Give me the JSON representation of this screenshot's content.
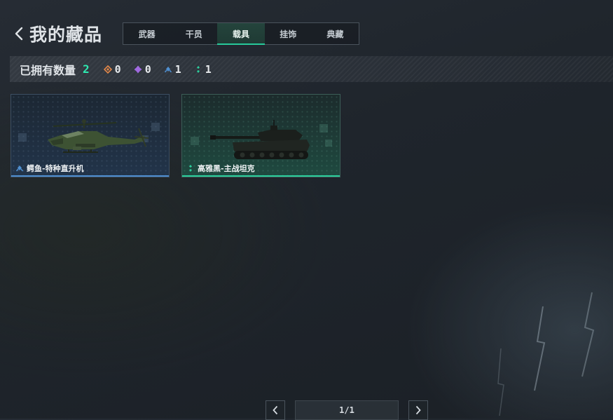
{
  "header": {
    "title": "我的藏品"
  },
  "tabs": [
    {
      "label": "武器",
      "active": false
    },
    {
      "label": "干员",
      "active": false
    },
    {
      "label": "载具",
      "active": true
    },
    {
      "label": "挂饰",
      "active": false
    },
    {
      "label": "典藏",
      "active": false
    }
  ],
  "stats": {
    "label": "已拥有数量",
    "owned": "2",
    "rarity_counts": [
      {
        "icon": "orange-rarity-icon",
        "color": "#e0874a",
        "count": "0"
      },
      {
        "icon": "purple-rarity-icon",
        "color": "#a06ae0",
        "count": "0"
      },
      {
        "icon": "blue-rarity-icon",
        "color": "#4f8fd0",
        "count": "1"
      },
      {
        "icon": "green-rarity-icon",
        "color": "#2ccf9d",
        "count": "1"
      }
    ]
  },
  "items": [
    {
      "name": "鳄鱼-特种直升机",
      "rarity": "blue",
      "rarity_color": "#4f8fd0",
      "icon": "helicopter-image"
    },
    {
      "name": "高雅黑-主战坦克",
      "rarity": "green",
      "rarity_color": "#2ccf9d",
      "icon": "tank-image"
    }
  ],
  "pagination": {
    "label": "1/1"
  },
  "colors": {
    "accent": "#27c99a",
    "owned_count": "#2ee8b0"
  }
}
